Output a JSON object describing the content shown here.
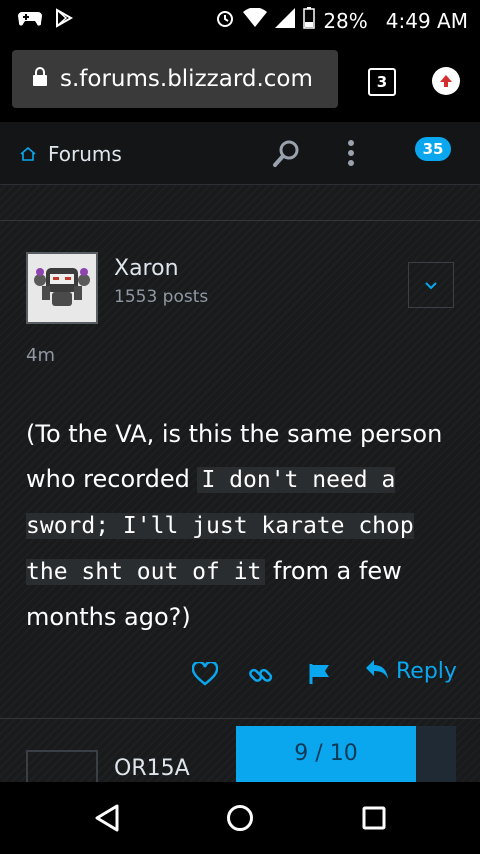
{
  "status": {
    "battery": "28%",
    "time": "4:49 AM"
  },
  "browser": {
    "url": "s.forums.blizzard.com",
    "tab_count": "3"
  },
  "forum": {
    "title": "Forums",
    "notification_count": "35"
  },
  "post": {
    "username": "Xaron",
    "post_count": "1553 posts",
    "time": "4m",
    "text_before": "(To the VA, is this the same person who recorded",
    "code": "I don't need a sword; I'll just karate chop the sht out of it",
    "text_after": "from a few months ago?)",
    "reply_label": "Reply"
  },
  "next_post": {
    "username": "OR15A"
  },
  "progress": {
    "label": "9 / 10",
    "current": 9,
    "total": 10
  },
  "colors": {
    "accent": "#0aa7ef",
    "background": "#181a1c"
  }
}
